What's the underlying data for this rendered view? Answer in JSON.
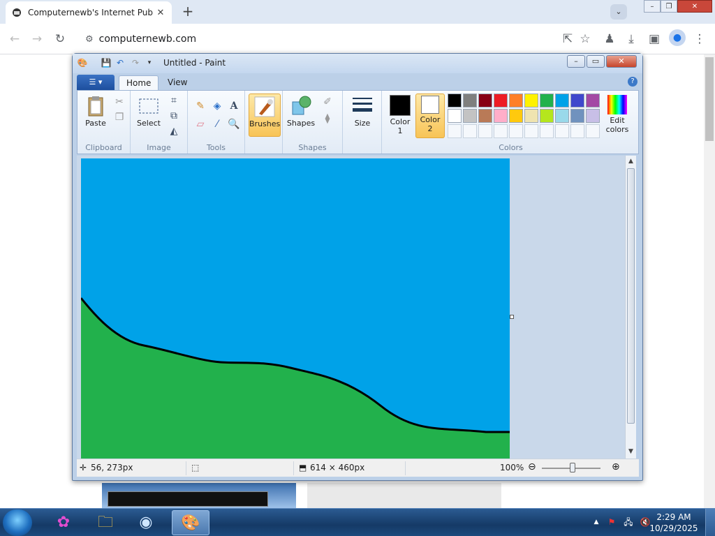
{
  "browser": {
    "tab_title": "Computernewb's Internet Pub H",
    "url": "computernewb.com"
  },
  "paint": {
    "title": "Untitled - Paint",
    "tabs": [
      "Home",
      "View"
    ],
    "groups": {
      "clipboard": {
        "label": "Clipboard",
        "paste": "Paste"
      },
      "image": {
        "label": "Image",
        "select": "Select"
      },
      "tools": {
        "label": "Tools"
      },
      "brushes": {
        "label": "Brushes"
      },
      "shapes": {
        "label": "Shapes",
        "button": "Shapes"
      },
      "size": {
        "label": "Size"
      },
      "colors": {
        "label": "Colors",
        "color1_line1": "Color",
        "color1_line2": "1",
        "color2_line1": "Color",
        "color2_line2": "2",
        "edit_line1": "Edit",
        "edit_line2": "colors",
        "color1": "#000000",
        "color2": "#ffffff",
        "palette_row1": [
          "#000000",
          "#7f7f7f",
          "#880015",
          "#ed1c24",
          "#ff7f27",
          "#fff200",
          "#22b14c",
          "#00a2e8",
          "#3f48cc",
          "#a349a4"
        ],
        "palette_row2": [
          "#ffffff",
          "#c3c3c3",
          "#b97a57",
          "#ffaec9",
          "#ffc90e",
          "#efe4b0",
          "#b5e61d",
          "#99d9ea",
          "#7092be",
          "#c8bfe7"
        ]
      }
    },
    "canvas": {
      "sky_color": "#00a2e8",
      "ground_color": "#22b14c",
      "line_color": "#000000"
    },
    "status": {
      "cursor_pos": "56, 273px",
      "canvas_size": "614 × 460px",
      "zoom": "100%"
    }
  },
  "taskbar": {
    "time": "2:29 AM",
    "date": "10/29/2025"
  }
}
